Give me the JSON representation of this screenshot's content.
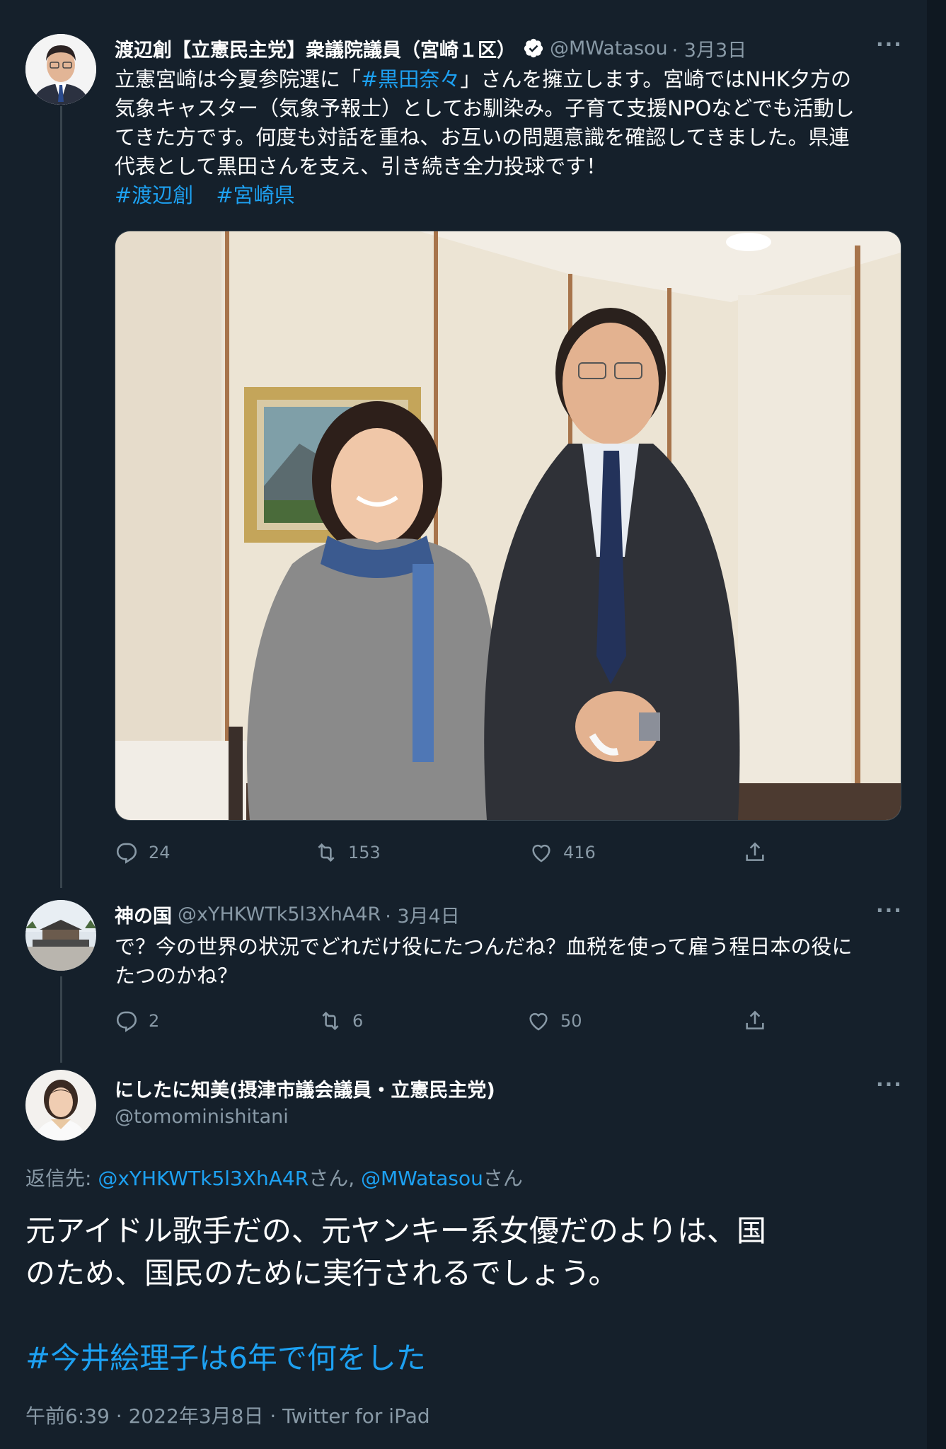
{
  "tweet1": {
    "name": "渡辺創【立憲民主党】衆議院議員（宮崎１区）",
    "handle": "@MWatasou",
    "date": "· 3月3日",
    "lines": [
      [
        "立憲宮崎は今夏参院選に「",
        "#黒田奈々",
        "」さんを擁立します。宮崎ではNHK夕方の"
      ],
      "気象キャスター（気象予報士）としてお馴染み。子育て支援NPOなどでも活動し",
      "てきた方です。何度も対話を重ね、お互いの問題意識を確認してきました。県連",
      "代表として黒田さんを支え、引き続き全力投球です！"
    ],
    "hashtags": [
      "#渡辺創",
      "#宮崎県"
    ],
    "replies": "24",
    "retweets": "153",
    "likes": "416"
  },
  "tweet2": {
    "name": "神の国",
    "handle": "@xYHKWTk5l3XhA4R",
    "date": "· 3月4日",
    "lines": [
      "で？今の世界の状況でどれだけ役にたつんだね？血税を使って雇う程日本の役に",
      "たつのかね？"
    ],
    "replies": "2",
    "retweets": "6",
    "likes": "50"
  },
  "tweet3": {
    "name": "にしたに知美(摂津市議会議員・立憲民主党)",
    "handle": "@tomominishitani",
    "reply_prefix": "返信先: ",
    "reply_to_1": "@xYHKWTk5l3XhA4R",
    "reply_san_1": "さん, ",
    "reply_to_2": "@MWatasou",
    "reply_san_2": "さん",
    "body_lines": [
      "元アイドル歌手だの、元ヤンキー系女優だのよりは、国",
      "のため、国民のために実行されるでしょう。"
    ],
    "hashtag": "#今井絵理子は6年で何をした",
    "meta": "午前6:39 · 2022年3月8日 · Twitter for iPad"
  },
  "more_label": "···",
  "colors": {
    "background": "#15202b",
    "link": "#1da1f2",
    "muted": "#8899a6",
    "thread_line": "#38444d"
  }
}
